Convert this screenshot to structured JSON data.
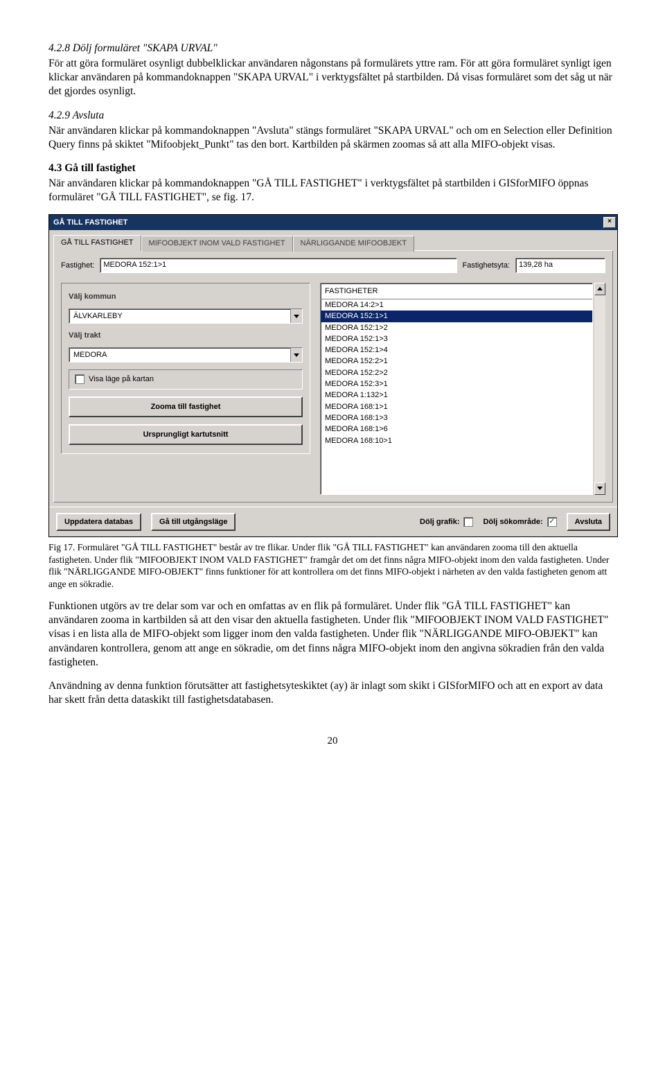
{
  "section428": {
    "heading": "4.2.8   Dölj formuläret \"SKAPA URVAL\"",
    "para": "För att göra formuläret osynligt dubbelklickar användaren någonstans på formulärets yttre ram. För att göra formuläret synligt igen klickar användaren på kommandoknappen \"SKAPA URVAL\" i verktygsfältet på startbilden. Då visas formuläret som det såg ut när det gjordes osynligt."
  },
  "section429": {
    "heading": "4.2.9   Avsluta",
    "para": "När användaren klickar på kommandoknappen \"Avsluta\" stängs formuläret \"SKAPA URVAL\" och om en Selection eller Definition Query finns på skiktet \"Mifoobjekt_Punkt\" tas den bort. Kartbilden på skärmen zoomas så att alla MIFO-objekt visas."
  },
  "section43": {
    "heading": "4.3  Gå till fastighet",
    "para": "När användaren klickar på kommandoknappen \"GÅ TILL FASTIGHET\" i verktygsfältet på startbilden i GISforMIFO öppnas formuläret \"GÅ TILL FASTIGHET\", se fig. 17."
  },
  "dialog": {
    "title": "GÅ TILL FASTIGHET",
    "tabs": [
      "GÅ TILL FASTIGHET",
      "MIFOOBJEKT INOM VALD FASTIGHET",
      "NÄRLIGGANDE MIFOOBJEKT"
    ],
    "fastighet_label": "Fastighet:",
    "fastighet_value": "MEDORA 152:1>1",
    "fastighetsyta_label": "Fastighetsyta:",
    "fastighetsyta_value": "139,28 ha",
    "left": {
      "kommun_label": "Välj kommun",
      "kommun_value": "ÄLVKARLEBY",
      "trakt_label": "Välj trakt",
      "trakt_value": "MEDORA",
      "checkbox_label": "Visa läge på kartan",
      "btn_zoom": "Zooma till fastighet",
      "btn_reset": "Ursprungligt kartutsnitt"
    },
    "list_header": "FASTIGHETER",
    "list_items": [
      "MEDORA 14:2>1",
      "MEDORA 152:1>1",
      "MEDORA 152:1>2",
      "MEDORA 152:1>3",
      "MEDORA 152:1>4",
      "MEDORA 152:2>1",
      "MEDORA 152:2>2",
      "MEDORA 152:3>1",
      "MEDORA 1:132>1",
      "MEDORA 168:1>1",
      "MEDORA 168:1>3",
      "MEDORA 168:1>6",
      "MEDORA 168:10>1"
    ],
    "list_selected_index": 1,
    "bottom": {
      "uppdatera": "Uppdatera databas",
      "utgang": "Gå till utgångsläge",
      "dolj_grafik": "Dölj grafik:",
      "dolj_sok": "Dölj sökområde:",
      "avsluta": "Avsluta"
    }
  },
  "caption": "Fig 17. Formuläret \"GÅ TILL FASTIGHET\" består av tre flikar. Under flik \"GÅ TILL FASTIGHET\" kan användaren zooma till den aktuella fastigheten. Under flik \"MIFOOBJEKT INOM VALD FASTIGHET\" framgår det om det finns några MIFO-objekt inom den valda fastigheten. Under flik \"NÄRLIGGANDE MIFO-OBJEKT\" finns funktioner för att kontrollera om det finns MIFO-objekt i närheten av den valda fastigheten genom att ange en sökradie.",
  "para_after1": "Funktionen utgörs av tre delar som var och en omfattas av en flik på formuläret. Under flik \"GÅ TILL FASTIGHET\" kan användaren zooma in kartbilden så att den visar den aktuella fastigheten. Under flik \"MIFOOBJEKT INOM VALD FASTIGHET\" visas i en lista alla de MIFO-objekt som ligger inom den valda fastigheten. Under flik \"NÄRLIGGANDE MIFO-OBJEKT\" kan användaren kontrollera, genom att ange en sökradie, om det finns några MIFO-objekt inom den angivna sökradien från den valda fastigheten.",
  "para_after2": "Användning av denna funktion förutsätter att fastighetsyteskiktet (ay) är inlagt som skikt i GISforMIFO och att en export av data har skett från detta dataskikt till fastighetsdatabasen.",
  "page_number": "20"
}
